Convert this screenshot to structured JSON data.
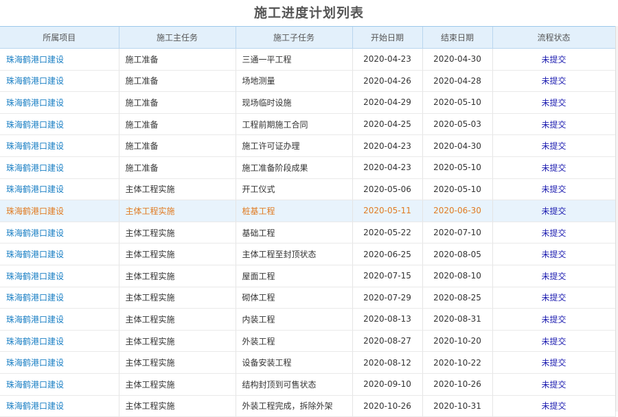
{
  "page": {
    "title": "施工进度计划列表"
  },
  "table": {
    "columns": [
      "所属项目",
      "施工主任务",
      "施工子任务",
      "开始日期",
      "结束日期",
      "流程状态"
    ],
    "selected_row": 7,
    "rows": [
      {
        "project": "珠海鹤港口建设",
        "main_task": "施工准备",
        "sub_task": "三通一平工程",
        "start": "2020-04-23",
        "end": "2020-04-30",
        "status": "未提交"
      },
      {
        "project": "珠海鹤港口建设",
        "main_task": "施工准备",
        "sub_task": "场地测量",
        "start": "2020-04-26",
        "end": "2020-04-28",
        "status": "未提交"
      },
      {
        "project": "珠海鹤港口建设",
        "main_task": "施工准备",
        "sub_task": "现场临时设施",
        "start": "2020-04-29",
        "end": "2020-05-10",
        "status": "未提交"
      },
      {
        "project": "珠海鹤港口建设",
        "main_task": "施工准备",
        "sub_task": "工程前期施工合同",
        "start": "2020-04-25",
        "end": "2020-05-03",
        "status": "未提交"
      },
      {
        "project": "珠海鹤港口建设",
        "main_task": "施工准备",
        "sub_task": "施工许可证办理",
        "start": "2020-04-23",
        "end": "2020-04-30",
        "status": "未提交"
      },
      {
        "project": "珠海鹤港口建设",
        "main_task": "施工准备",
        "sub_task": "施工准备阶段成果",
        "start": "2020-04-23",
        "end": "2020-05-10",
        "status": "未提交"
      },
      {
        "project": "珠海鹤港口建设",
        "main_task": "主体工程实施",
        "sub_task": "开工仪式",
        "start": "2020-05-06",
        "end": "2020-05-10",
        "status": "未提交"
      },
      {
        "project": "珠海鹤港口建设",
        "main_task": "主体工程实施",
        "sub_task": "桩基工程",
        "start": "2020-05-11",
        "end": "2020-06-30",
        "status": "未提交"
      },
      {
        "project": "珠海鹤港口建设",
        "main_task": "主体工程实施",
        "sub_task": "基础工程",
        "start": "2020-05-22",
        "end": "2020-07-10",
        "status": "未提交"
      },
      {
        "project": "珠海鹤港口建设",
        "main_task": "主体工程实施",
        "sub_task": "主体工程至封顶状态",
        "start": "2020-06-25",
        "end": "2020-08-05",
        "status": "未提交"
      },
      {
        "project": "珠海鹤港口建设",
        "main_task": "主体工程实施",
        "sub_task": "屋面工程",
        "start": "2020-07-15",
        "end": "2020-08-10",
        "status": "未提交"
      },
      {
        "project": "珠海鹤港口建设",
        "main_task": "主体工程实施",
        "sub_task": "砌体工程",
        "start": "2020-07-29",
        "end": "2020-08-25",
        "status": "未提交"
      },
      {
        "project": "珠海鹤港口建设",
        "main_task": "主体工程实施",
        "sub_task": "内装工程",
        "start": "2020-08-13",
        "end": "2020-08-31",
        "status": "未提交"
      },
      {
        "project": "珠海鹤港口建设",
        "main_task": "主体工程实施",
        "sub_task": "外装工程",
        "start": "2020-08-27",
        "end": "2020-10-20",
        "status": "未提交"
      },
      {
        "project": "珠海鹤港口建设",
        "main_task": "主体工程实施",
        "sub_task": "设备安装工程",
        "start": "2020-08-12",
        "end": "2020-10-22",
        "status": "未提交"
      },
      {
        "project": "珠海鹤港口建设",
        "main_task": "主体工程实施",
        "sub_task": "结构封顶到可售状态",
        "start": "2020-09-10",
        "end": "2020-10-26",
        "status": "未提交"
      },
      {
        "project": "珠海鹤港口建设",
        "main_task": "主体工程实施",
        "sub_task": "外装工程完成，拆除外架",
        "start": "2020-10-26",
        "end": "2020-10-31",
        "status": "未提交"
      }
    ]
  },
  "colors": {
    "header_bg": "#e3f0fb",
    "project_link": "#1a7fc4",
    "status_link": "#1c1cb0",
    "selected_row_bg": "#e8f3fc",
    "selected_row_text": "#e07b22"
  }
}
